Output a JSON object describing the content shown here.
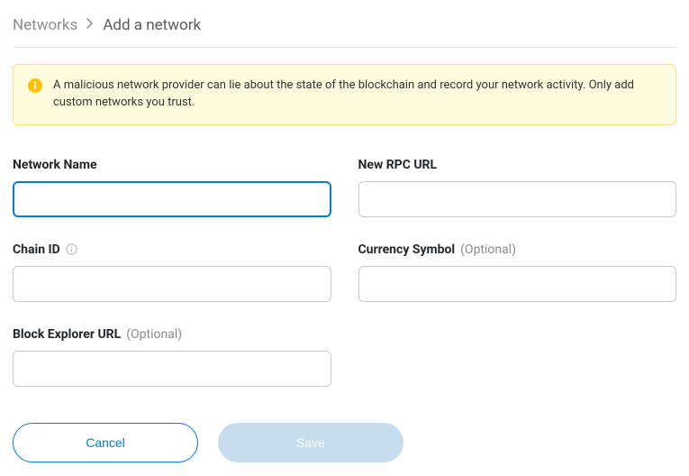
{
  "breadcrumb": {
    "parent": "Networks",
    "current": "Add a network"
  },
  "warning": {
    "text": "A malicious network provider can lie about the state of the blockchain and record your network activity. Only add custom networks you trust."
  },
  "fields": {
    "network_name": {
      "label": "Network Name",
      "value": ""
    },
    "rpc_url": {
      "label": "New RPC URL",
      "value": ""
    },
    "chain_id": {
      "label": "Chain ID",
      "value": ""
    },
    "currency_symbol": {
      "label": "Currency Symbol",
      "optional": "(Optional)",
      "value": ""
    },
    "block_explorer": {
      "label": "Block Explorer URL",
      "optional": "(Optional)",
      "value": ""
    }
  },
  "actions": {
    "cancel": "Cancel",
    "save": "Save"
  }
}
